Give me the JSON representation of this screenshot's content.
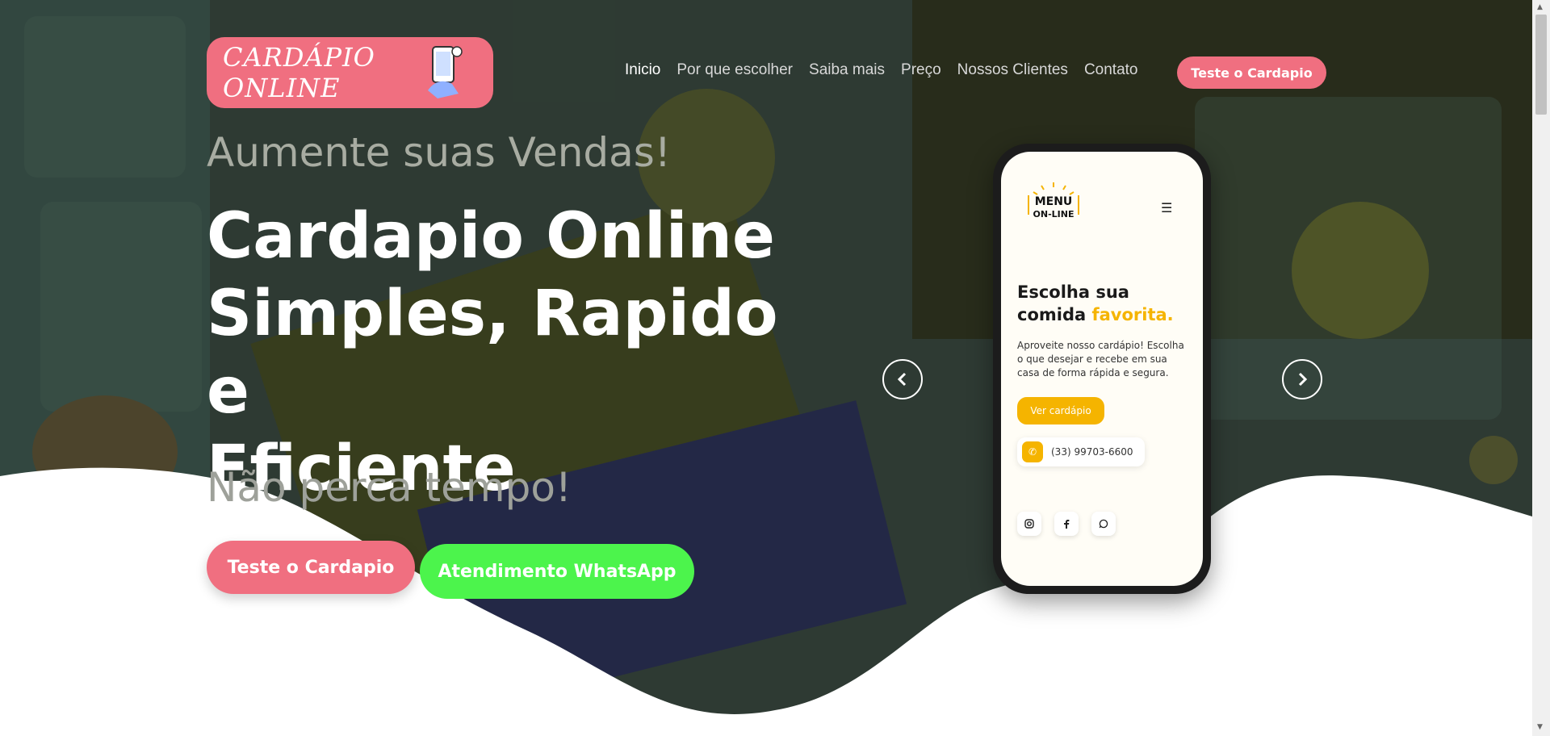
{
  "logo": {
    "text": "CARDÁPIO ONLINE"
  },
  "nav": {
    "items": [
      {
        "label": "Inicio",
        "active": true
      },
      {
        "label": "Por que escolher",
        "active": false
      },
      {
        "label": "Saiba mais",
        "active": false
      },
      {
        "label": "Preço",
        "active": false
      },
      {
        "label": "Nossos Clientes",
        "active": false
      },
      {
        "label": "Contato",
        "active": false
      }
    ],
    "cta": "Teste o Cardapio"
  },
  "hero": {
    "subtitle_top": "Aumente suas Vendas!",
    "title_line1": "Cardapio Online",
    "title_line2": "Simples, Rapido e",
    "title_line3": "Eficiente",
    "subtitle_bottom": "Não perca tempo!",
    "btn_primary": "Teste o Cardapio",
    "btn_whatsapp": "Atendimento WhatsApp"
  },
  "phone": {
    "logo_line1": "MENU",
    "logo_line2": "ON-LINE",
    "headline_part1": "Escolha sua comida ",
    "headline_highlight": "favorita.",
    "paragraph": "Aproveite nosso cardápio! Escolha o que desejar e recebe em sua casa de forma rápida e segura.",
    "button": "Ver cardápio",
    "phone_number": "(33) 99703-6600"
  },
  "colors": {
    "brand_pink": "#f06f80",
    "whatsapp_green": "#4cf44c",
    "accent_yellow": "#f5b400"
  }
}
